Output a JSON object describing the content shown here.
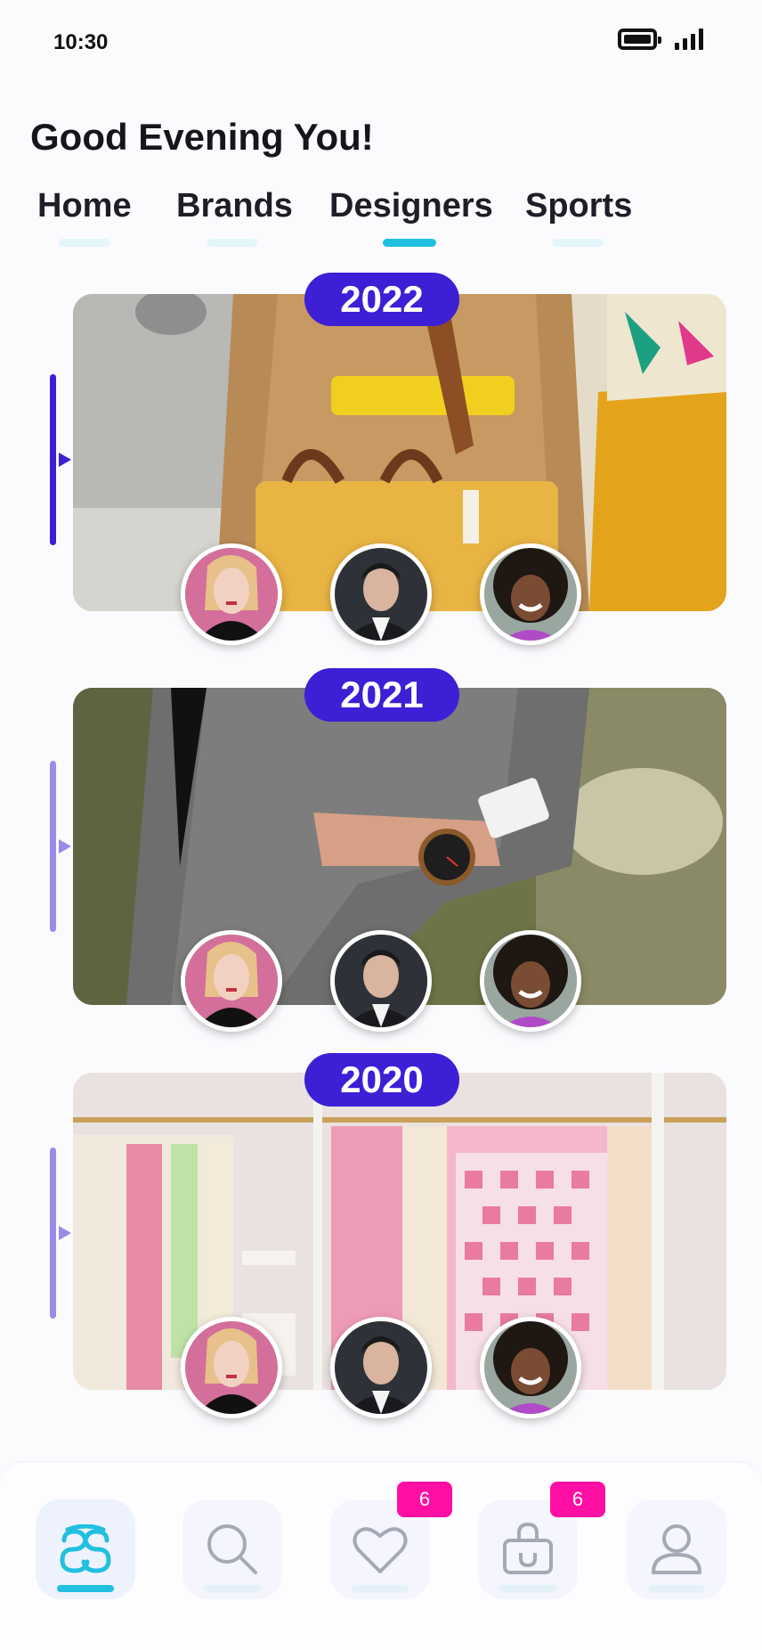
{
  "status_bar": {
    "time": "10:30"
  },
  "greeting": "Good Evening You!",
  "tabs": [
    {
      "label": "Home",
      "active": false
    },
    {
      "label": "Brands",
      "active": false
    },
    {
      "label": "Designers",
      "active": true
    },
    {
      "label": "Sports",
      "active": false
    }
  ],
  "collections": [
    {
      "year": "2022",
      "photo": "woman-with-yellow-tote-bag",
      "highlighted": true
    },
    {
      "year": "2021",
      "photo": "man-in-grey-suit-with-watch",
      "highlighted": false
    },
    {
      "year": "2020",
      "photo": "pink-and-cream-clothing-rack",
      "highlighted": false
    }
  ],
  "designers": [
    "blonde-woman-avatar",
    "dark-haired-man-avatar",
    "curly-haired-girl-avatar"
  ],
  "bottom_nav": {
    "items": [
      {
        "icon": "home-logo-icon",
        "active": true
      },
      {
        "icon": "search-icon",
        "active": false
      },
      {
        "icon": "heart-icon",
        "active": false,
        "badge": "6"
      },
      {
        "icon": "shopping-bag-icon",
        "active": false,
        "badge": "6"
      },
      {
        "icon": "profile-icon",
        "active": false
      }
    ]
  },
  "colors": {
    "accent": "#3d1fd6",
    "accent_muted": "#9c8ae8",
    "tab_indicator": "#21bfe0",
    "badge": "#ff0fa3"
  }
}
